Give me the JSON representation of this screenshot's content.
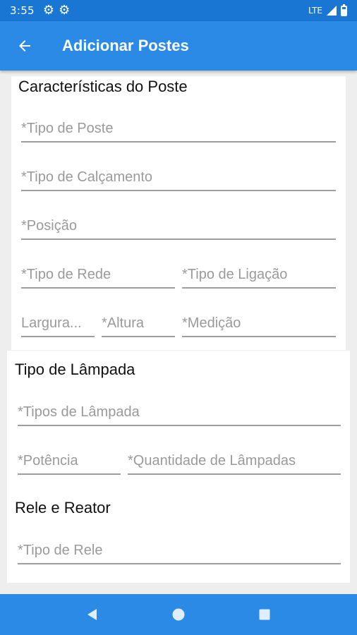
{
  "status_bar": {
    "time": "3:55",
    "network": "LTE",
    "icons": [
      "gear-icon",
      "gear-icon",
      "signal-icon",
      "battery-icon"
    ]
  },
  "app_bar": {
    "title": "Adicionar Postes",
    "back_icon": "arrow-left-icon",
    "color": "#2b8ae6"
  },
  "sections": {
    "poste": {
      "title": "Características do Poste",
      "fields": {
        "tipo_poste": "*Tipo de Poste",
        "tipo_calcamento": "*Tipo de Calçamento",
        "posicao": "*Posição",
        "tipo_rede": "*Tipo de Rede",
        "tipo_ligacao": "*Tipo de Ligação",
        "largura": "Largura...",
        "altura": "*Altura",
        "medicao": "*Medição"
      }
    },
    "lampada": {
      "title": "Tipo de Lâmpada",
      "fields": {
        "tipos_lampada": "*Tipos de Lâmpada",
        "potencia": "*Potência",
        "quantidade": "*Quantidade de Lâmpadas"
      }
    },
    "rele": {
      "title": "Rele e Reator",
      "fields": {
        "tipo_rele": "*Tipo de Rele"
      }
    }
  },
  "nav_bar": {
    "buttons": [
      "back-triangle-icon",
      "home-circle-icon",
      "recents-square-icon"
    ]
  }
}
